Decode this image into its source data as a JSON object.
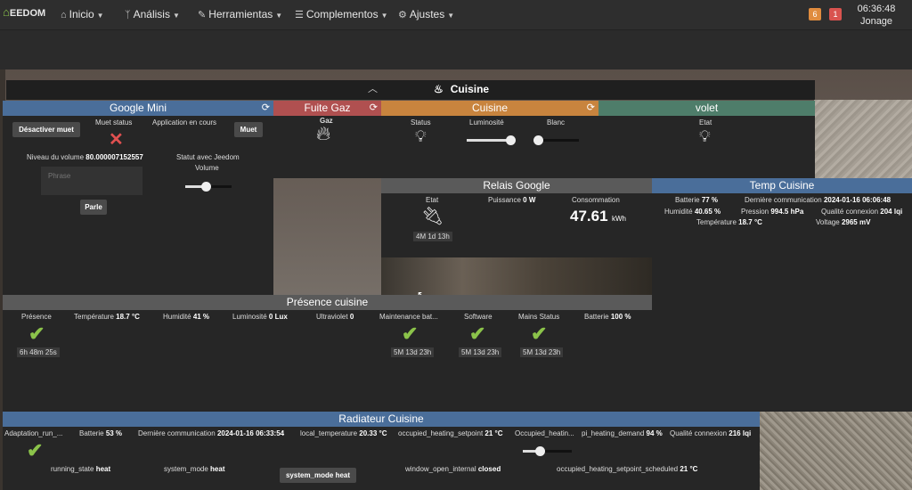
{
  "navbar": {
    "logo_text": "EEDOM",
    "menus": [
      {
        "label": "Inicio",
        "icon": "home-icon"
      },
      {
        "label": "Análisis",
        "icon": "stethoscope-icon"
      },
      {
        "label": "Herramientas",
        "icon": "wrench-icon"
      },
      {
        "label": "Complementos",
        "icon": "list-icon"
      },
      {
        "label": "Ajustes",
        "icon": "gear-icon"
      }
    ],
    "badge_warning": "6",
    "badge_alert": "1",
    "time": "06:36:48",
    "user": "Jonage",
    "colors": {
      "warning": "#e08c3e",
      "alert": "#d9534f"
    }
  },
  "room": {
    "title": "Cuisine",
    "collapse_icon": "chevron-up-icon"
  },
  "google_mini": {
    "title": "Google Mini",
    "header_color": "#4a6e9a",
    "desactiver_label": "Désactiver muet",
    "muet_status_label": "Muet status",
    "application_label": "Application en cours",
    "muet_label": "Muet",
    "niveau_label": "Niveau du volume",
    "niveau_value": "80.000007152557",
    "statut_label": "Statut avec Jeedom",
    "phrase_placeholder": "Phrase",
    "volume_label": "Volume",
    "volume_level": 0.45,
    "parle_label": "Parle"
  },
  "fuite_gaz": {
    "title": "Fuite Gaz",
    "header_color": "#b05050",
    "gaz_label": "Gaz"
  },
  "cuisine": {
    "title": "Cuisine",
    "header_color": "#c8843e",
    "status_label": "Status",
    "luminosite_label": "Luminosité",
    "luminosite_level": 0.95,
    "blanc_label": "Blanc",
    "blanc_level": 0.05
  },
  "volet": {
    "title": "volet",
    "header_color": "#4e7d6a",
    "etat_label": "Etat"
  },
  "relais": {
    "title": "Relais Google",
    "header_color": "#5a5a5a",
    "etat_label": "Etat",
    "etat_time": "4M 1d 13h",
    "puissance_label": "Puissance",
    "puissance_value": "0 W",
    "consommation_label": "Consommation",
    "consommation_value": "47.61",
    "consommation_unit": "kWh"
  },
  "temp": {
    "title": "Temp Cuisine",
    "header_color": "#4a6e9a",
    "batterie_label": "Batterie",
    "batterie_value": "77 %",
    "derniere_label": "Dernière communication",
    "derniere_value": "2024-01-16 06:06:48",
    "humidite_label": "Humidité",
    "humidite_value": "40.65 %",
    "pression_label": "Pression",
    "pression_value": "994.5 hPa",
    "qualite_label": "Qualité connexion",
    "qualite_value": "204 lqi",
    "temperature_label": "Température",
    "temperature_value": "18.7 °C",
    "voltage_label": "Voltage",
    "voltage_value": "2965 mV"
  },
  "presence": {
    "title": "Présence cuisine",
    "header_color": "#5a5a5a",
    "presence_label": "Présence",
    "presence_time": "6h 48m 25s",
    "temperature_label": "Température",
    "temperature_value": "18.7 °C",
    "humidite_label": "Humidité",
    "humidite_value": "41 %",
    "luminosite_label": "Luminosité",
    "luminosite_value": "0 Lux",
    "ultraviolet_label": "Ultraviolet",
    "ultraviolet_value": "0",
    "maintenance_label": "Maintenance bat...",
    "maintenance_time": "5M 13d 23h",
    "software_label": "Software",
    "software_time": "5M 13d 23h",
    "mains_label": "Mains Status",
    "mains_time": "5M 13d 23h",
    "batterie_label": "Batterie",
    "batterie_value": "100 %"
  },
  "radiateur": {
    "title": "Radiateur Cuisine",
    "header_color": "#4a6e9a",
    "adaptation_label": "Adaptation_run_...",
    "batterie_label": "Batterie",
    "batterie_value": "53 %",
    "derniere_label": "Dernière communication",
    "derniere_value": "2024-01-16 06:33:54",
    "local_temp_label": "local_temperature",
    "local_temp_value": "20.33 °C",
    "occ_setpoint_label": "occupied_heating_setpoint",
    "occ_setpoint_value": "21 °C",
    "occ_heatin_label": "Occupied_heatin...",
    "pi_label": "pi_heating_demand",
    "pi_value": "94 %",
    "qualite_label": "Qualité connexion",
    "qualite_value": "216 lqi",
    "running_label": "running_state",
    "running_value": "heat",
    "system_mode_label": "system_mode",
    "system_mode_value": "heat",
    "system_mode_btn": "system_mode heat",
    "window_label": "window_open_internal",
    "window_value": "closed",
    "occ_sched_label": "occupied_heating_setpoint_scheduled",
    "occ_sched_value": "21 °C",
    "setpoint_level": 0.35
  }
}
